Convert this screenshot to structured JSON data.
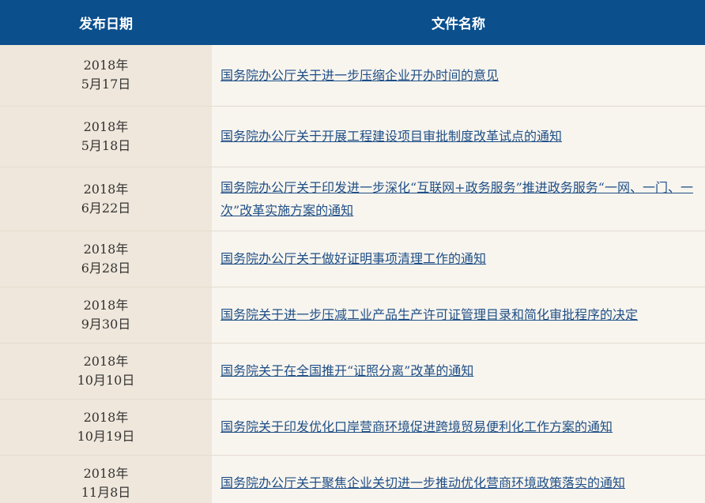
{
  "header": {
    "date_label": "发布日期",
    "title_label": "文件名称"
  },
  "rows": [
    {
      "year": "2018年",
      "day": "5月17日",
      "title": "国务院办公厅关于进一步压缩企业开办时间的意见"
    },
    {
      "year": "2018年",
      "day": "5月18日",
      "title": "国务院办公厅关于开展工程建设项目审批制度改革试点的通知"
    },
    {
      "year": "2018年",
      "day": "6月22日",
      "title": "国务院办公厅关于印发进一步深化“互联网+政务服务”推进政务服务“一网、一门、一次”改革实施方案的通知"
    },
    {
      "year": "2018年",
      "day": "6月28日",
      "title": "国务院办公厅关于做好证明事项清理工作的通知"
    },
    {
      "year": "2018年",
      "day": "9月30日",
      "title": "国务院关于进一步压减工业产品生产许可证管理目录和简化审批程序的决定"
    },
    {
      "year": "2018年",
      "day": "10月10日",
      "title": "国务院关于在全国推开“证照分离”改革的通知"
    },
    {
      "year": "2018年",
      "day": "10月19日",
      "title": "国务院关于印发优化口岸营商环境促进跨境贸易便利化工作方案的通知"
    },
    {
      "year": "2018年",
      "day": "11月8日",
      "title": "国务院办公厅关于聚焦企业关切进一步推动优化营商环境政策落实的通知"
    }
  ],
  "colors": {
    "header_bg": "#0b4f8c",
    "date_bg": "#efe7db",
    "title_bg": "#f8f5ef",
    "link": "#1f4f86"
  }
}
